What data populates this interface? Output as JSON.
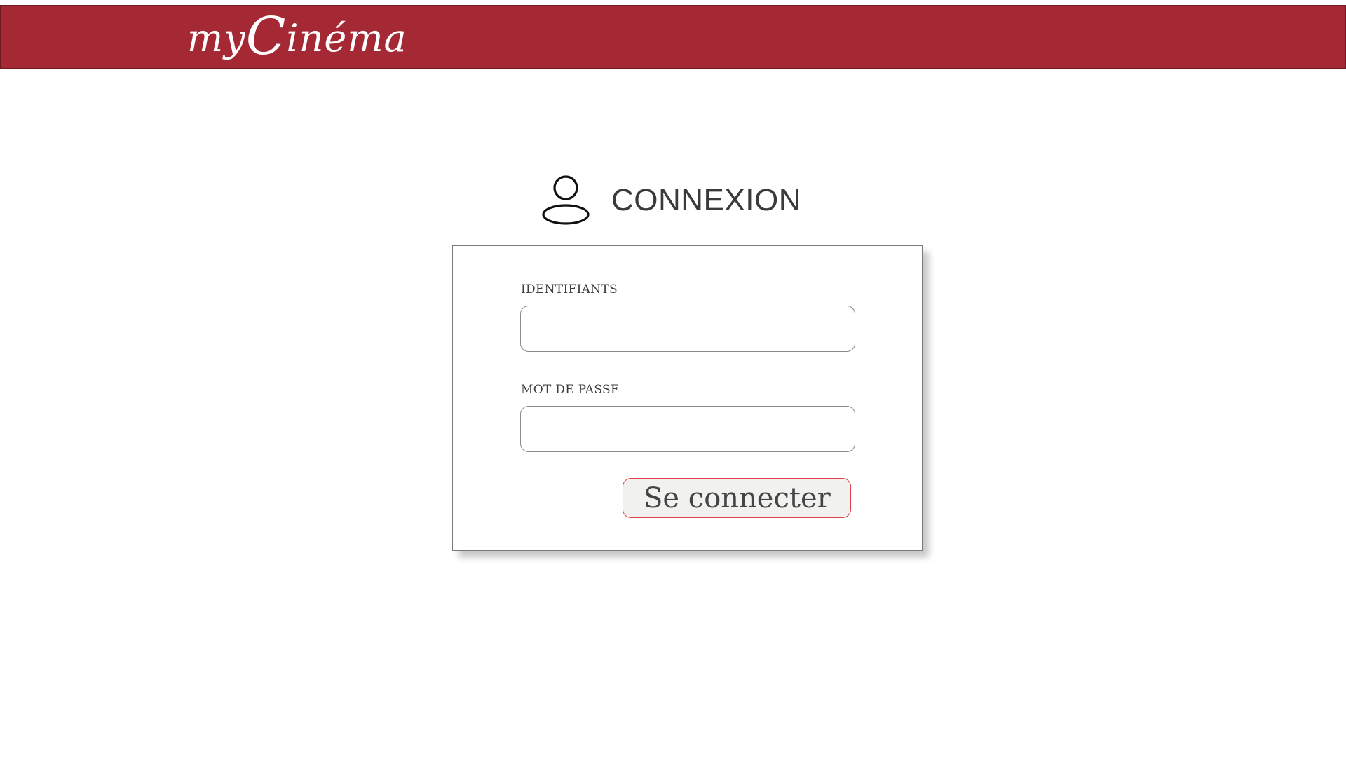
{
  "header": {
    "logo_prefix": "my",
    "logo_initial": "C",
    "logo_rest": "inéma",
    "background_color": "#a52935"
  },
  "login": {
    "icon": "user-icon",
    "title": "CONNEXION",
    "username_label": "IDENTIFIANTS",
    "username_value": "",
    "password_label": "MOT DE PASSE",
    "password_value": "",
    "submit_label": "Se connecter",
    "submit_border_color": "#e0404a"
  }
}
